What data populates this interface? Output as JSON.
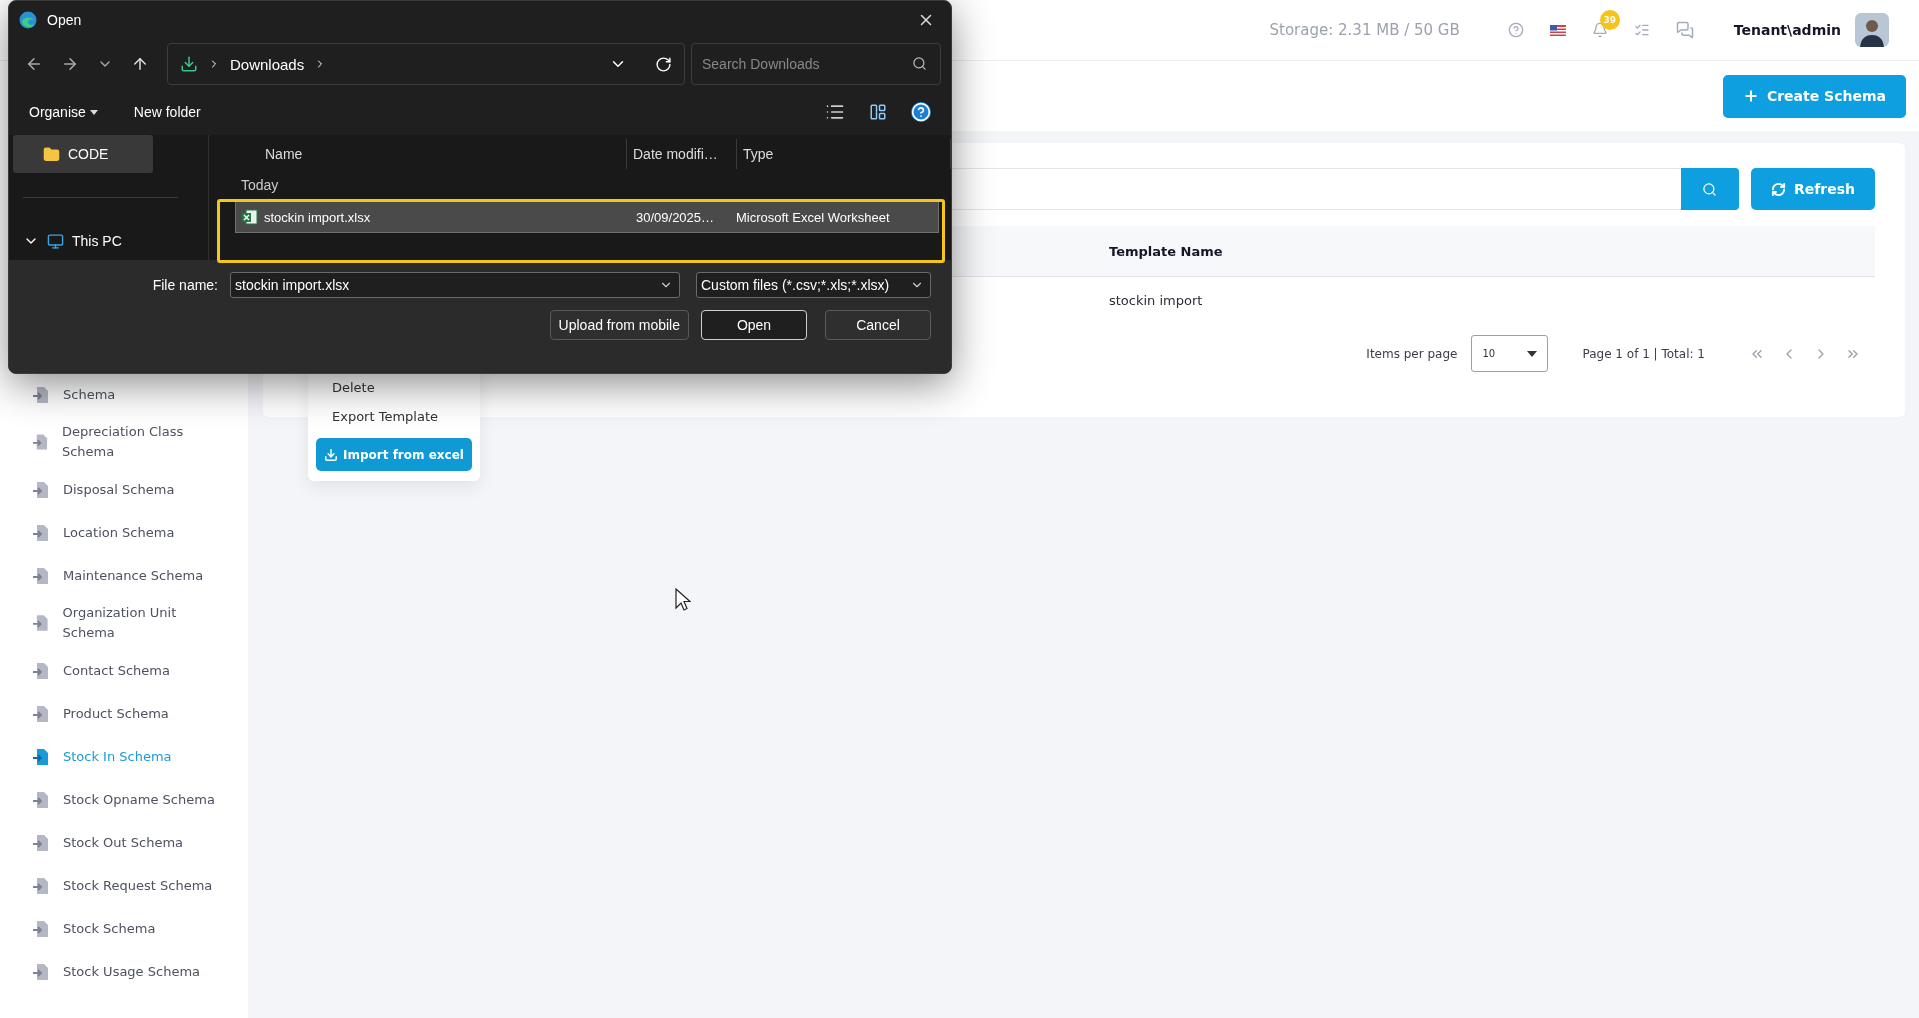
{
  "header": {
    "storage": "Storage: 2.31 MB / 50 GB",
    "notification_count": "39",
    "user": "Tenant\\admin"
  },
  "create_button": "Create Schema",
  "sidebar": {
    "items": [
      {
        "label": "Schema",
        "selected": false
      },
      {
        "label": "Depreciation Class Schema",
        "selected": false
      },
      {
        "label": "Disposal Schema",
        "selected": false
      },
      {
        "label": "Location Schema",
        "selected": false
      },
      {
        "label": "Maintenance Schema",
        "selected": false
      },
      {
        "label": "Organization Unit Schema",
        "selected": false
      },
      {
        "label": "Contact Schema",
        "selected": false
      },
      {
        "label": "Product Schema",
        "selected": false
      },
      {
        "label": "Stock In Schema",
        "selected": true
      },
      {
        "label": "Stock Opname Schema",
        "selected": false
      },
      {
        "label": "Stock Out Schema",
        "selected": false
      },
      {
        "label": "Stock Request Schema",
        "selected": false
      },
      {
        "label": "Stock Schema",
        "selected": false
      },
      {
        "label": "Stock Usage Schema",
        "selected": false
      }
    ]
  },
  "card": {
    "refresh": "Refresh",
    "table": {
      "columns": [
        "Template Name"
      ],
      "rows": [
        [
          "stockin import"
        ]
      ]
    },
    "pagination": {
      "items_per_page_label": "Items per page",
      "per_page": "10",
      "summary": "Page 1 of 1 | Total: 1"
    }
  },
  "context_menu": {
    "items": [
      {
        "label": "Delete",
        "kind": "item"
      },
      {
        "label": "Export Template",
        "kind": "item"
      },
      {
        "label": "Import from excel",
        "kind": "button"
      }
    ]
  },
  "dialog": {
    "title": "Open",
    "address": "Downloads",
    "search": {
      "placeholder": "Search Downloads"
    },
    "commands": [
      "Organise",
      "New folder"
    ],
    "nav_pane": [
      {
        "label": "CODE",
        "kind": "folder",
        "selected": true
      },
      {
        "label": "This PC",
        "kind": "pc",
        "selected": false
      }
    ],
    "columns": [
      "Name",
      "Date modifi…",
      "Type"
    ],
    "group": "Today",
    "files": [
      {
        "name": "stockin import.xlsx",
        "date": "30/09/2025…",
        "type": "Microsoft Excel Worksheet",
        "selected": true
      }
    ],
    "file_name": {
      "label": "File name:",
      "value": "stockin import.xlsx"
    },
    "filter": "Custom files (*.csv;*.xls;*.xlsx)",
    "buttons": [
      {
        "label": "Upload from mobile",
        "default": false
      },
      {
        "label": "Open",
        "default": true
      },
      {
        "label": "Cancel",
        "default": false
      }
    ]
  }
}
